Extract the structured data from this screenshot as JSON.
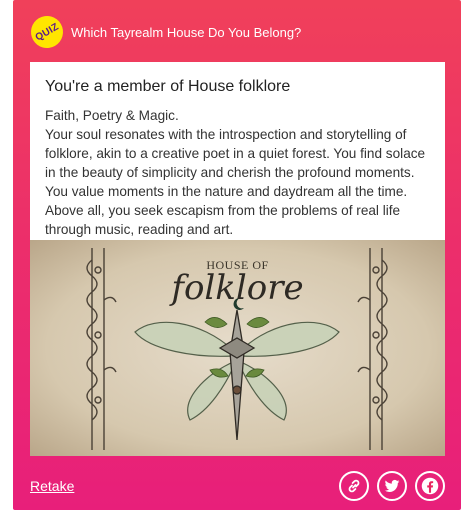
{
  "header": {
    "badge_label": "QUIZ",
    "title": "Which Tayrealm House Do You Belong?"
  },
  "result": {
    "title": "You're a member of House folklore",
    "body": "Faith, Poetry & Magic.\nYour soul resonates with the introspection and storytelling of folklore, akin to a creative poet in a quiet forest. You find solace in the beauty of simplicity and cherish the profound moments. You value moments in the nature and daydream all the time. Above all, you seek escapism from the problems of real life through music, reading and art."
  },
  "artwork": {
    "top_text": "HOUSE OF",
    "main_text": "folklore"
  },
  "footer": {
    "retake_label": "Retake",
    "share_icons": [
      "link-icon",
      "twitter-icon",
      "facebook-icon"
    ]
  },
  "colors": {
    "card_top": "#f0405a",
    "card_bottom": "#e81f7a",
    "badge": "#ffe600"
  }
}
